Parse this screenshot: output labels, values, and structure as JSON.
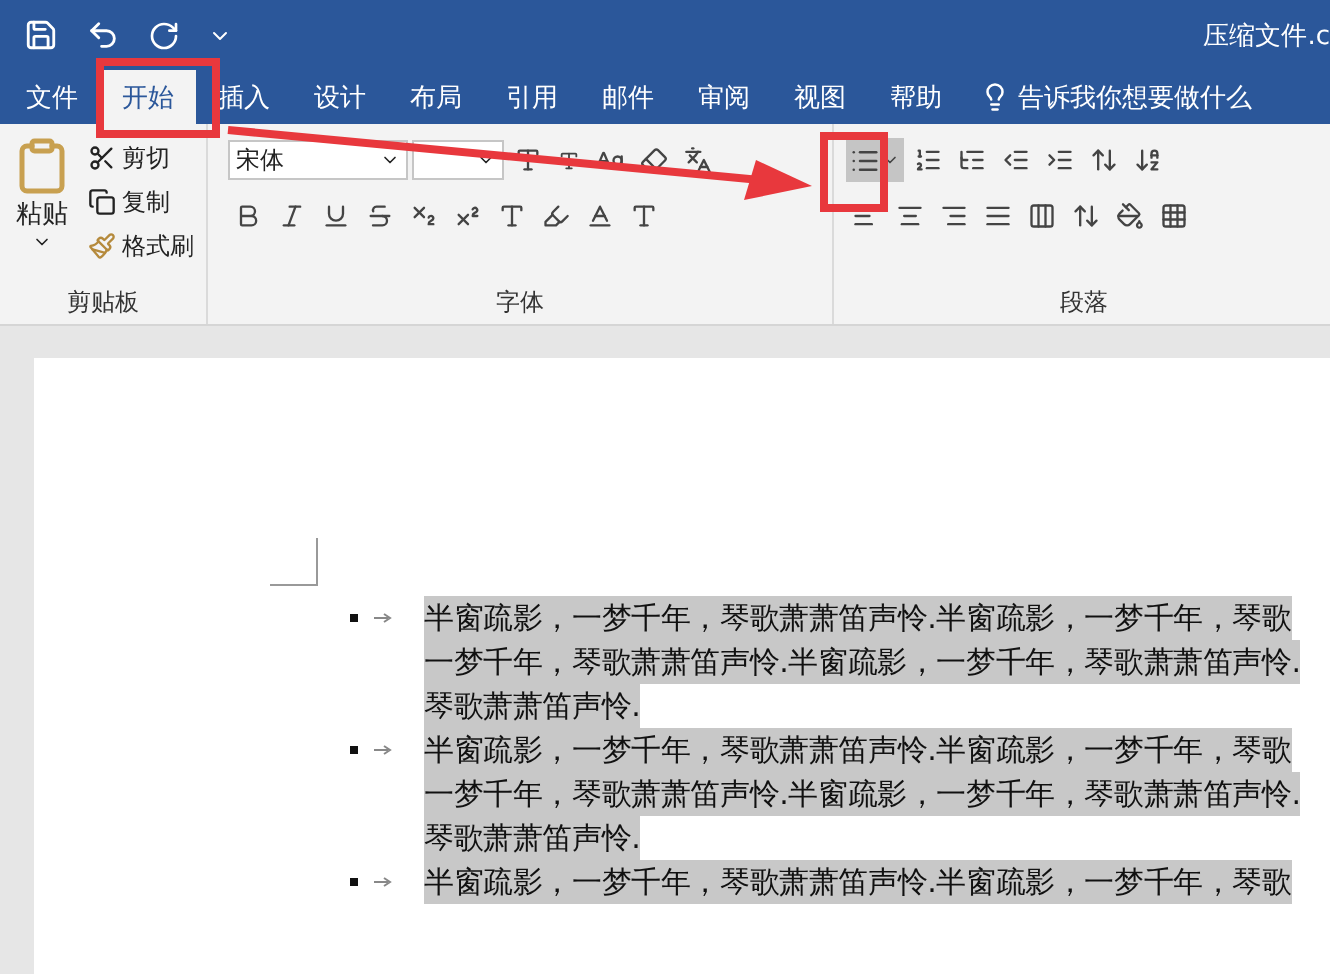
{
  "window": {
    "title": "压缩文件.c"
  },
  "tabs": [
    {
      "label": "文件",
      "selected": false
    },
    {
      "label": "开始",
      "selected": true
    },
    {
      "label": "插入",
      "selected": false
    },
    {
      "label": "设计",
      "selected": false
    },
    {
      "label": "布局",
      "selected": false
    },
    {
      "label": "引用",
      "selected": false
    },
    {
      "label": "邮件",
      "selected": false
    },
    {
      "label": "审阅",
      "selected": false
    },
    {
      "label": "视图",
      "selected": false
    },
    {
      "label": "帮助",
      "selected": false
    }
  ],
  "tell_me": "告诉我你想要做什么",
  "clipboard": {
    "paste": "粘贴",
    "cut": "剪切",
    "copy": "复制",
    "format_painter": "格式刷",
    "label": "剪贴板"
  },
  "font": {
    "name": "宋体",
    "label": "字体"
  },
  "paragraph": {
    "bullets_on": true,
    "label": "段落"
  },
  "document": {
    "paragraphs": [
      {
        "selected": true,
        "lines": [
          "半窗疏影，一梦千年，琴歌萧萧笛声怜.半窗疏影，一梦千年，琴歌",
          "一梦千年，琴歌萧萧笛声怜.半窗疏影，一梦千年，琴歌萧萧笛声怜.",
          "琴歌萧萧笛声怜."
        ]
      },
      {
        "selected": true,
        "lines": [
          "半窗疏影，一梦千年，琴歌萧萧笛声怜.半窗疏影，一梦千年，琴歌",
          "一梦千年，琴歌萧萧笛声怜.半窗疏影，一梦千年，琴歌萧萧笛声怜.",
          "琴歌萧萧笛声怜."
        ]
      },
      {
        "selected": true,
        "lines": [
          "半窗疏影，一梦千年，琴歌萧萧笛声怜.半窗疏影，一梦千年，琴歌"
        ]
      }
    ]
  }
}
